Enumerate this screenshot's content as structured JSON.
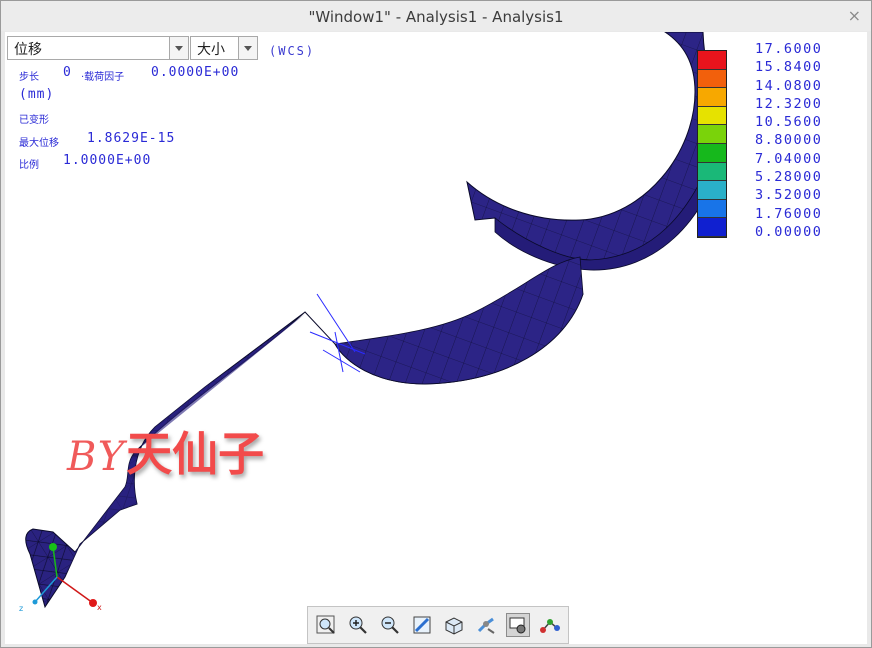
{
  "window": {
    "title": "\"Window1\" - Analysis1 - Analysis1"
  },
  "controls": {
    "result_type": "位移",
    "component": "大小",
    "coord_system": "(WCS)"
  },
  "info": {
    "step_label": "步长",
    "step_value": "0",
    "load_factor_label": "·载荷因子",
    "load_factor_value": "0.0000E+00",
    "units": "(mm)",
    "deformed": "已变形",
    "max_disp_label": "最大位移",
    "max_disp_value": "1.8629E-15",
    "scale_label": "比例",
    "scale_value": "1.0000E+00"
  },
  "legend": {
    "values": [
      "17.6000",
      "15.8400",
      "14.0800",
      "12.3200",
      "10.5600",
      "8.80000",
      "7.04000",
      "5.28000",
      "3.52000",
      "1.76000",
      "0.00000"
    ],
    "colors": [
      "#e8141c",
      "#f2600c",
      "#f7a800",
      "#e6e200",
      "#7ad30a",
      "#16b81c",
      "#1ab878",
      "#2ab0c8",
      "#1874e8",
      "#1020d0"
    ]
  },
  "triad": {
    "x": "x",
    "y": "y",
    "z": "z"
  },
  "watermark": {
    "by": "BY",
    "name": "天仙子"
  },
  "toolbar": {
    "buttons": [
      {
        "icon": "zoom-fit-icon"
      },
      {
        "icon": "zoom-in-icon"
      },
      {
        "icon": "zoom-out-icon"
      },
      {
        "icon": "repaint-icon"
      },
      {
        "icon": "display-style-icon"
      },
      {
        "icon": "view-orientation-icon"
      },
      {
        "icon": "animate-display-icon"
      },
      {
        "icon": "datum-display-icon"
      }
    ]
  },
  "colors": {
    "model_fill": "#2a2280",
    "mesh_lines": "#0a0a2a",
    "info_text": "#2a2ad6"
  }
}
